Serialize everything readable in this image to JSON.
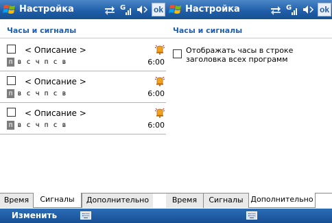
{
  "colors": {
    "title_bar": "#1f5da8",
    "heading": "#1f5da8",
    "active_day": "#7c7c7c"
  },
  "left": {
    "window_title": "Настройка",
    "ok_label": "ok",
    "heading": "Часы и сигналы",
    "alarms": [
      {
        "description": "< Описание >",
        "days": [
          "п",
          "в",
          "с",
          "ч",
          "п",
          "с",
          "в"
        ],
        "active_day_index": 0,
        "time": "6:00",
        "enabled": false,
        "icon": "alarm-bell-icon"
      },
      {
        "description": "< Описание >",
        "days": [
          "п",
          "в",
          "с",
          "ч",
          "п",
          "с",
          "в"
        ],
        "active_day_index": 0,
        "time": "6:00",
        "enabled": false,
        "icon": "alarm-bell-icon"
      },
      {
        "description": "< Описание >",
        "days": [
          "п",
          "в",
          "с",
          "ч",
          "п",
          "с",
          "в"
        ],
        "active_day_index": 0,
        "time": "6:00",
        "enabled": false,
        "icon": "alarm-bell-icon"
      }
    ],
    "tabs": [
      {
        "label": "Время",
        "active": false
      },
      {
        "label": "Сигналы",
        "active": true
      },
      {
        "label": "Дополнительно",
        "active": false
      }
    ],
    "menu_left": "Изменить"
  },
  "right": {
    "window_title": "Настройка",
    "ok_label": "ok",
    "heading": "Часы и сигналы",
    "option_label": "Отображать часы в строке заголовка всех программ",
    "option_checked": false,
    "tabs": [
      {
        "label": "Время",
        "active": false
      },
      {
        "label": "Сигналы",
        "active": false
      },
      {
        "label": "Дополнительно",
        "active": true
      }
    ]
  }
}
